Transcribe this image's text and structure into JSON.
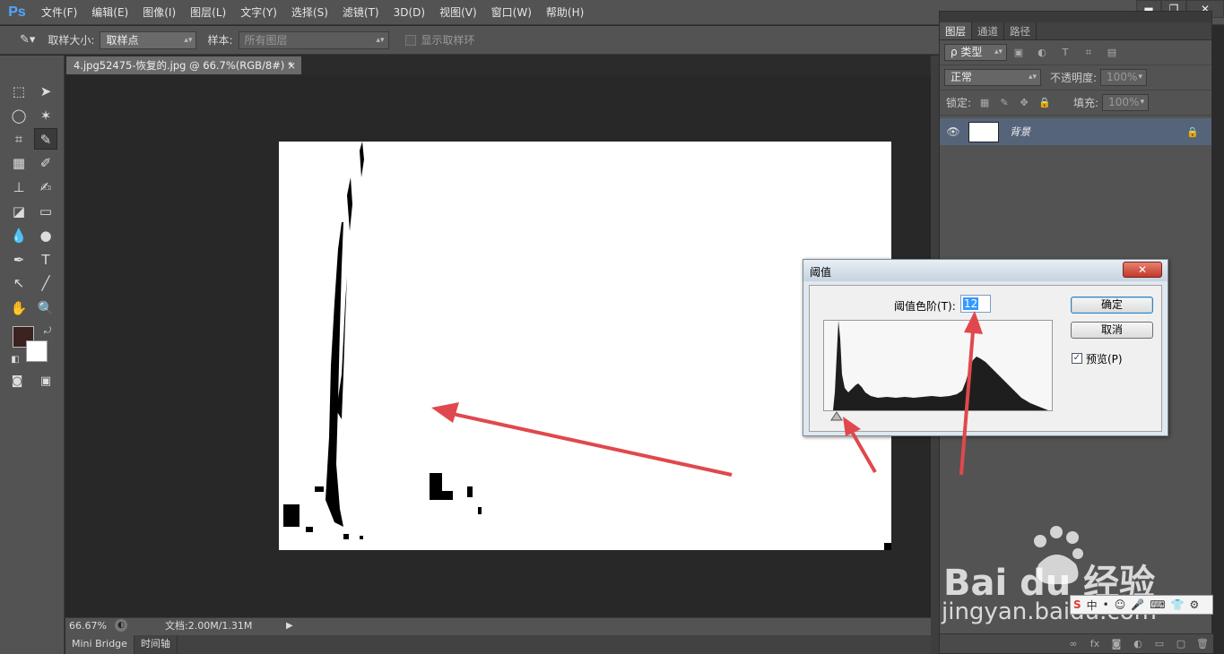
{
  "app": {
    "logo": "Ps"
  },
  "menu": [
    "文件(F)",
    "编辑(E)",
    "图像(I)",
    "图层(L)",
    "文字(Y)",
    "选择(S)",
    "滤镜(T)",
    "3D(D)",
    "视图(V)",
    "窗口(W)",
    "帮助(H)"
  ],
  "window_controls": {
    "minimize": "▬",
    "restore": "❐",
    "close": "✕"
  },
  "options": {
    "sample_size_label": "取样大小:",
    "sample_size_value": "取样点",
    "sample_label": "样本:",
    "sample_value": "所有图层",
    "show_ring_label": "显示取样环"
  },
  "document": {
    "tab_title": "4.jpg52475-恢复的.jpg @ 66.7%(RGB/8#) *",
    "close": "×",
    "zoom": "66.67%",
    "doc_size": "文档:2.00M/1.31M"
  },
  "bottom_tabs": [
    "Mini Bridge",
    "时间轴"
  ],
  "colors": {
    "foreground": "#3a2320",
    "background": "#ffffff",
    "arrow": "#e0484d"
  },
  "layers_panel": {
    "tabs": [
      "图层",
      "通道",
      "路径"
    ],
    "filter_kind": "ρ 类型",
    "blend_mode": "正常",
    "opacity_label": "不透明度:",
    "opacity_value": "100%",
    "lock_label": "锁定:",
    "fill_label": "填充:",
    "fill_value": "100%",
    "layer": {
      "name": "背景"
    }
  },
  "threshold_dialog": {
    "title": "阈值",
    "close": "✕",
    "level_label": "阈值色阶(T):",
    "level_value": "12",
    "ok_label": "确定",
    "cancel_label": "取消",
    "preview_label": "预览(P)",
    "preview_checked": true
  },
  "ime_bar": [
    "S",
    "中",
    "•",
    "☺",
    "🎤",
    "⌨",
    "👕",
    "⚙"
  ],
  "watermark": {
    "brand": "Bai du 经验",
    "url": "jingyan.baidu.com"
  }
}
